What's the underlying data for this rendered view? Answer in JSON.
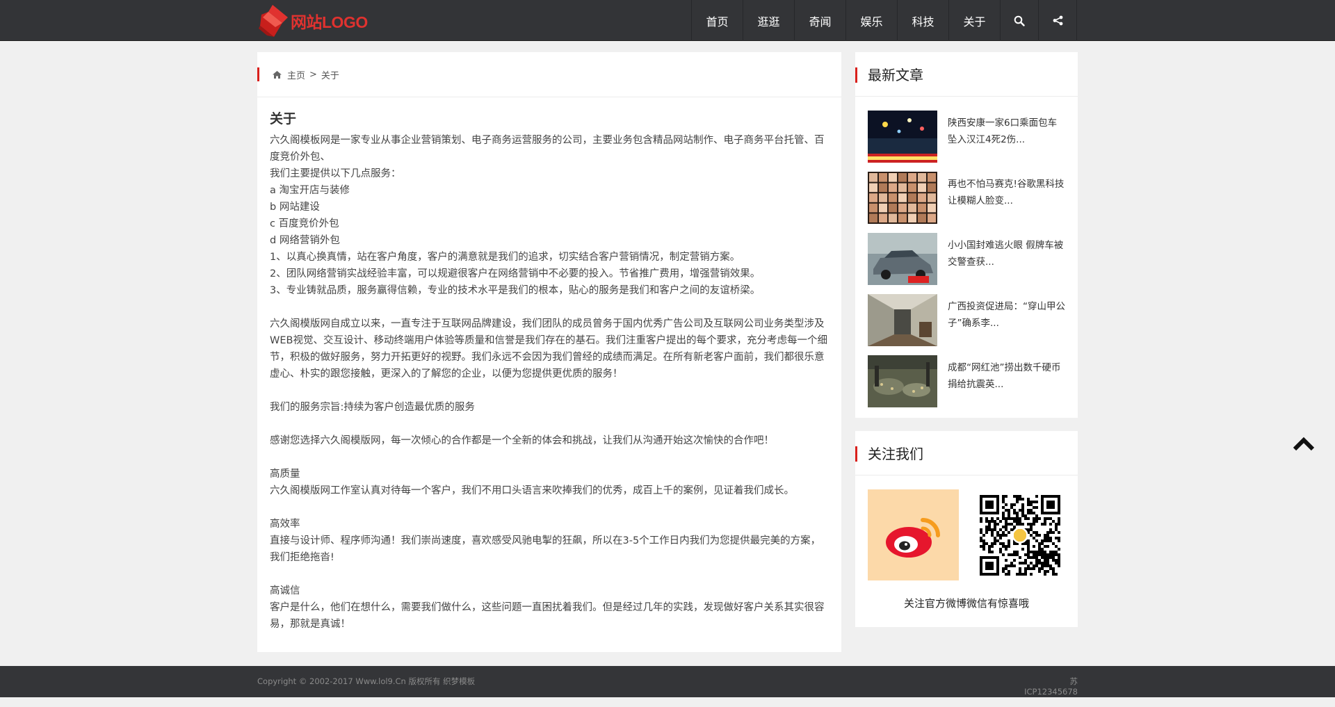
{
  "header": {
    "logo_text": "网站LOGO",
    "nav": [
      "首页",
      "逛逛",
      "奇闻",
      "娱乐",
      "科技",
      "关于"
    ],
    "search_icon": "search-icon",
    "share_icon": "share-icon",
    "accent_color": "#e0322f"
  },
  "breadcrumb": {
    "home": "主页",
    "separator": ">",
    "current": "关于"
  },
  "article": {
    "title": "关于",
    "paragraphs": [
      "六久阁模板网是一家专业从事企业营销策划、电子商务运营服务的公司，主要业务包含精品网站制作、电子商务平台托管、百度竞价外包、",
      "我们主要提供以下几点服务：",
      "a  淘宝开店与装修",
      "b  网站建设",
      "c  百度竞价外包",
      "d  网络营销外包",
      "1、以真心换真情，站在客户角度，客户的满意就是我们的追求，切实结合客户营销情况，制定营销方案。",
      "2、团队网络营销实战经验丰富，可以规避很客户在网络营销中不必要的投入。节省推广费用，增强营销效果。",
      "3、专业铸就品质，服务赢得信赖，专业的技术水平是我们的根本，贴心的服务是我们和客户之间的友谊桥梁。",
      "",
      "六久阁模版网自成立以来，一直专注于互联网品牌建设，我们团队的成员曾务于国内优秀广告公司及互联网公司业务类型涉及WEB视觉、交互设计、移动终端用户体验等质量和信誉是我们存在的基石。我们注重客户提出的每个要求，充分考虑每一个细节，积极的做好服务，努力开拓更好的视野。我们永远不会因为我们曾经的成绩而满足。在所有新老客户面前，我们都很乐意虚心、朴实的跟您接触，更深入的了解您的企业，以便为您提供更优质的服务！",
      "",
      "我们的服务宗旨:持续为客户创造最优质的服务",
      "",
      "感谢您选择六久阁模版网，每一次倾心的合作都是一个全新的体会和挑战，让我们从沟通开始这次愉快的合作吧！",
      "",
      "高质量",
      "六久阁模版网工作室认真对待每一个客户，我们不用口头语言来吹捧我们的优秀，成百上千的案例，见证着我们成长。",
      "",
      "高效率",
      "直接与设计师、程序师沟通！我们崇尚速度，喜欢感受风驰电掣的狂飙，所以在3-5个工作日内我们为您提供最完美的方案，我们拒绝拖沓!",
      "",
      "高诚信",
      "客户是什么，他们在想什么，需要我们做什么，这些问题一直困扰着我们。但是经过几年的实践，发现做好客户关系其实很容易，那就是真诚！"
    ]
  },
  "sidebar": {
    "latest": {
      "title": "最新文章",
      "items": [
        {
          "title": "陕西安康一家6口乘面包车坠入汉江4死2伤...",
          "thumb": "night-rescue-photo"
        },
        {
          "title": "再也不怕马赛克!谷歌黑科技让模糊人脸变...",
          "thumb": "face-grid-photo"
        },
        {
          "title": "小小国封难逃火眼 假牌车被交警查获...",
          "thumb": "grey-car-photo"
        },
        {
          "title": "广西投资促进局：“穿山甲公子”确系李...",
          "thumb": "corridor-photo"
        },
        {
          "title": "成都“网红池”捞出数千硬币 捐给抗震英...",
          "thumb": "coin-pool-photo"
        }
      ]
    },
    "follow": {
      "title": "关注我们",
      "caption": "关注官方微博微信有惊喜哦"
    }
  },
  "footer": {
    "copyright": "Copyright © 2002-2017 Www.lol9.Cn 版权所有 织梦模板",
    "icp": "苏ICP12345678"
  }
}
